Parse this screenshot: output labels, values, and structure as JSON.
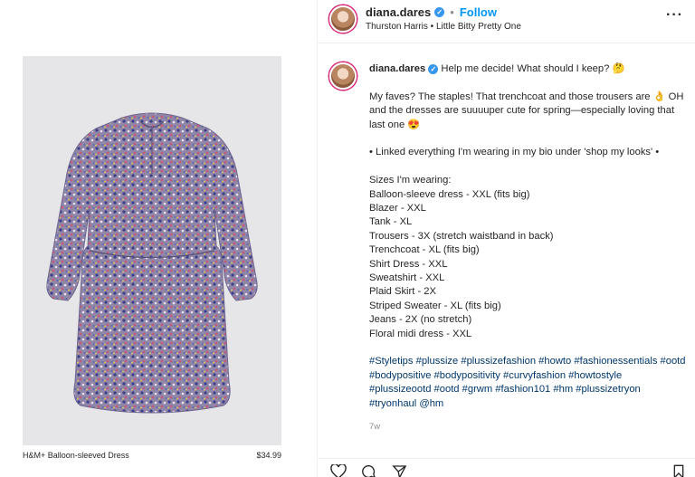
{
  "media": {
    "product_name": "H&M+ Balloon-sleeved Dress",
    "price": "$34.99",
    "bg_color": "#e6e6e8"
  },
  "header": {
    "username": "diana.dares",
    "follow_label": "Follow",
    "separator": "•",
    "audio": "Thurston Harris • Little Bitty Pretty One",
    "more_icon": "more-dots-icon"
  },
  "post": {
    "username": "diana.dares",
    "line1": "Help me decide! What should I keep? 🤔",
    "para2": "My faves? The staples! That trenchcoat and those trousers are 👌 OH and the dresses are suuuuper cute for spring—especially loving that last one 😍",
    "para3": "• Linked everything I'm wearing in my bio under 'shop my looks' •",
    "sizes_title": "Sizes I'm wearing:",
    "sizes": [
      "Balloon-sleeve dress - XXL (fits big)",
      "Blazer - XXL",
      "Tank - XL",
      "Trousers - 3X (stretch waistband in back)",
      "Trenchcoat - XL (fits big)",
      "Shirt Dress - XXL",
      "Sweatshirt - XXL",
      "Plaid Skirt - 2X",
      "Striped Sweater - XL (fits big)",
      "Jeans - 2X (no stretch)",
      "Floral midi dress - XXL"
    ],
    "hashtags": "#Styletips #plussize #plussizefashion #howto #fashionessentials #ootd #bodypositive #bodypositivity #curvyfashion #howtostyle #plussizeootd #ootd #grwm #fashion101 #hm #plussizetryon #tryonhaul @hm",
    "time_ago": "7w"
  },
  "actions": {
    "like_icon": "heart-icon",
    "comment_icon": "comment-icon",
    "share_icon": "share-icon",
    "save_icon": "bookmark-icon"
  },
  "colors": {
    "link": "#0095f6",
    "hashtag": "#00376b",
    "verified": "#3897f0"
  }
}
